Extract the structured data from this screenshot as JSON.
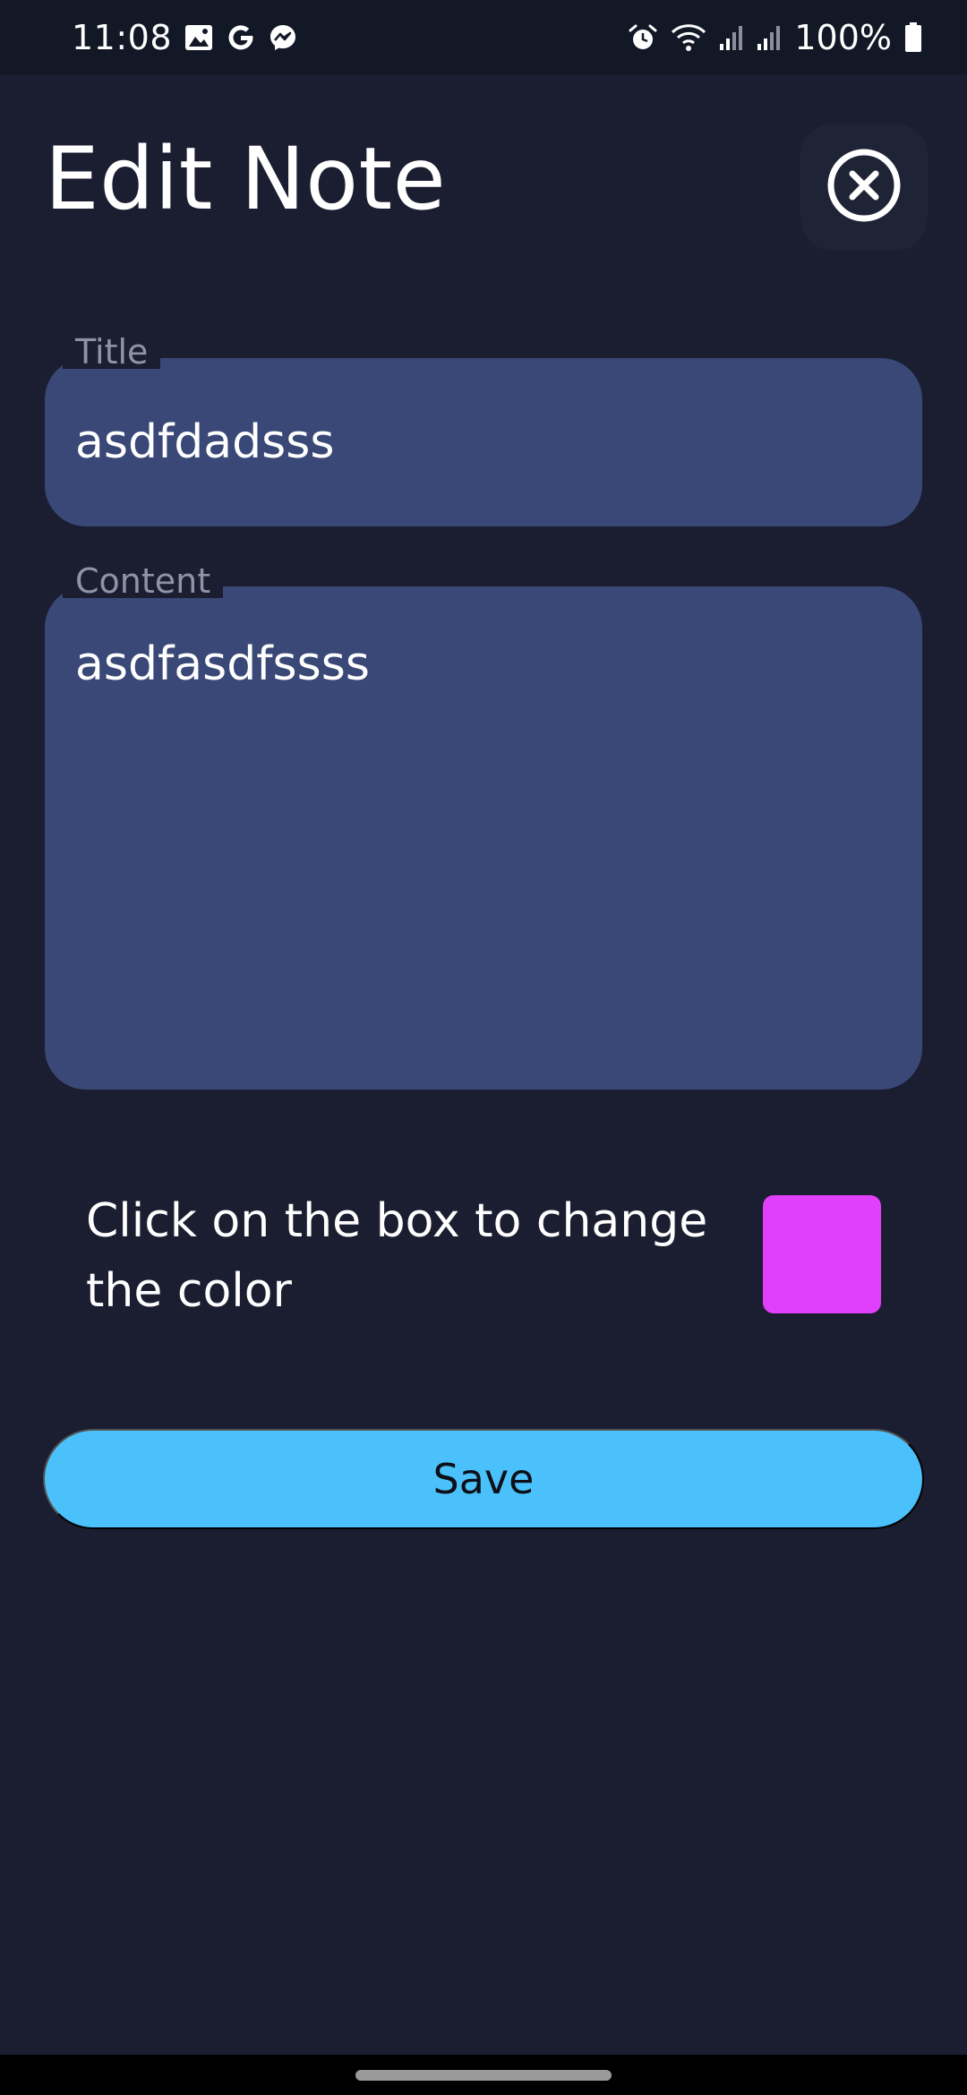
{
  "status_bar": {
    "time": "11:08",
    "battery_text": "100%",
    "left_icons": [
      "image-icon",
      "google-icon",
      "messenger-icon"
    ],
    "right_icons": [
      "alarm-icon",
      "wifi-icon",
      "signal-icon",
      "signal-icon",
      "battery-icon"
    ]
  },
  "header": {
    "title": "Edit Note",
    "close_icon": "close-circle-icon"
  },
  "form": {
    "title_label": "Title",
    "title_value": "asdfdadsss",
    "content_label": "Content",
    "content_value": "asdfasdfssss"
  },
  "color_picker": {
    "instruction": "Click on the box to change the color",
    "selected_color": "#e040fb"
  },
  "actions": {
    "save_label": "Save"
  },
  "colors": {
    "background": "#1b1e31",
    "field_background": "#394877",
    "accent": "#4bc1fb"
  }
}
